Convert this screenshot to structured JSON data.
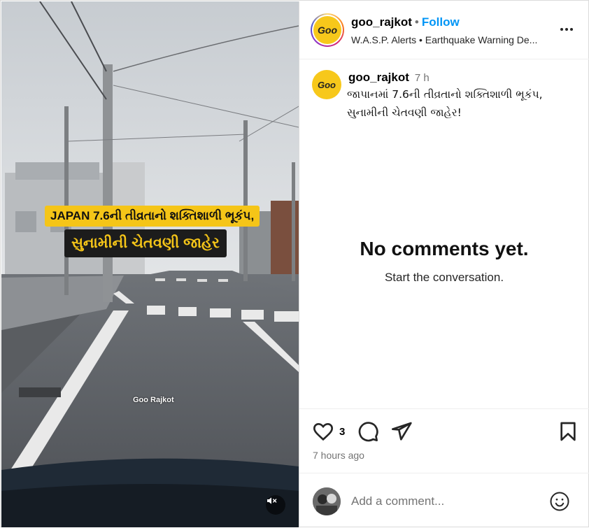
{
  "video": {
    "overlay_line1": "JAPAN 7.6ની તીવ્રતાનો શક્તિશાળી ભૂકંપ,",
    "overlay_line2": "સુનામીની ચેતવણી જાહેર",
    "watermark": "Goo Rajkot",
    "mute_icon": "speaker-muted-icon"
  },
  "header": {
    "username": "goo_rajkot",
    "separator": "•",
    "follow_label": "Follow",
    "subtitle": "W.A.S.P. Alerts • Earthquake Warning De...",
    "more_icon": "more-options-icon",
    "logo_text": "Goo"
  },
  "caption": {
    "username": "goo_rajkot",
    "time": "7 h",
    "text": "જાપાનમાં 7.6ની તીવ્રતાનો શક્તિશાળી ભૂકંપ, સુનામીની ચેતવણી જાહેર!"
  },
  "comments": {
    "empty_title": "No comments yet.",
    "empty_subtitle": "Start the conversation."
  },
  "actions": {
    "like_icon": "heart-icon",
    "like_count": "3",
    "comment_icon": "comment-icon",
    "share_icon": "share-icon",
    "save_icon": "bookmark-icon",
    "post_age": "7 hours ago"
  },
  "comment_bar": {
    "placeholder": "Add a comment...",
    "emoji_icon": "emoji-icon"
  },
  "colors": {
    "follow_blue": "#0095f6",
    "brand_yellow": "#f7c81b",
    "muted_text": "#737373"
  }
}
